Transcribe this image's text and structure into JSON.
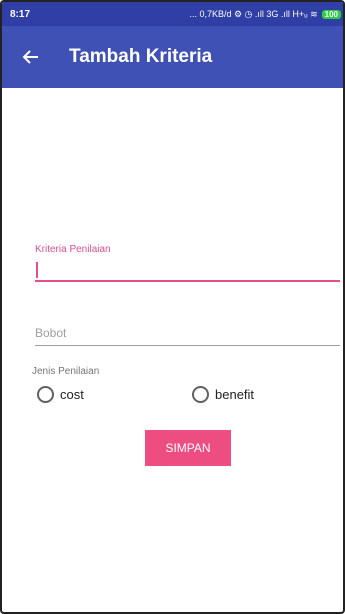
{
  "status": {
    "time": "8:17",
    "indicators": "... 0,7KB/d ⚙ ◷ .ıll 3G .ıll H+ᵤ ≋",
    "battery": "100"
  },
  "appbar": {
    "back_icon": "arrow-left-icon",
    "title": "Tambah Kriteria"
  },
  "form": {
    "kriteria_label": "Kriteria Penilaian",
    "kriteria_value": "",
    "bobot_placeholder": "Bobot",
    "jenis_label": "Jenis Penilaian",
    "options": [
      {
        "label": "cost",
        "selected": false
      },
      {
        "label": "benefit",
        "selected": false
      }
    ],
    "submit_label": "SIMPAN"
  },
  "colors": {
    "primary": "#3f51b5",
    "status_bar": "#2f3fa6",
    "accent": "#ee4d82"
  }
}
